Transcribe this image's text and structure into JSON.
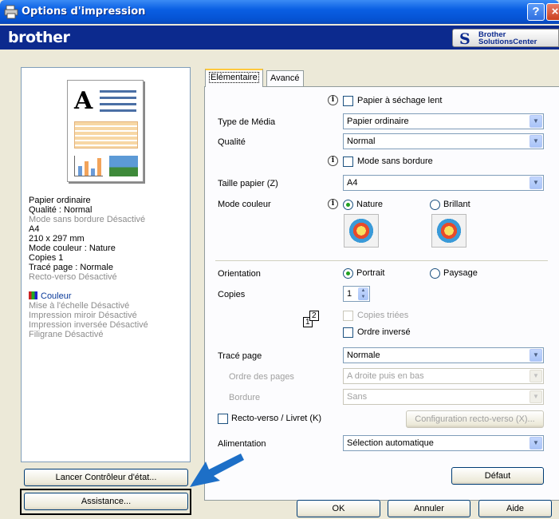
{
  "window": {
    "title": "Options d'impression",
    "help_glyph": "?",
    "close_glyph": "×"
  },
  "brand": {
    "logo": "brother",
    "solutions_line1": "Brother",
    "solutions_line2": "SolutionsCenter"
  },
  "summary": {
    "lines": [
      {
        "text": "Papier ordinaire",
        "grey": false
      },
      {
        "text": "Qualité : Normal",
        "grey": false
      },
      {
        "text": "Mode sans bordure Désactivé",
        "grey": true
      },
      {
        "text": "A4",
        "grey": false
      },
      {
        "text": "210 x 297 mm",
        "grey": false
      },
      {
        "text": "Mode couleur : Nature",
        "grey": false
      },
      {
        "text": "Copies 1",
        "grey": false
      },
      {
        "text": "Tracé page : Normale",
        "grey": false
      },
      {
        "text": "Recto-verso Désactivé",
        "grey": true
      }
    ],
    "color_label": "Couleur",
    "lines2": [
      "Mise à l'échelle Désactivé",
      "Impression miroir Désactivé",
      "Impression inversée Désactivé",
      "Filigrane Désactivé"
    ]
  },
  "left_buttons": {
    "status_monitor": "Lancer Contrôleur d'état...",
    "assistance": "Assistance..."
  },
  "tabs": [
    {
      "label": "Elémentaire",
      "active": true
    },
    {
      "label": "Avancé",
      "active": false
    }
  ],
  "form": {
    "slow_dry_label": "Papier à séchage lent",
    "media_type_label": "Type de Média",
    "media_type_value": "Papier ordinaire",
    "quality_label": "Qualité",
    "quality_value": "Normal",
    "borderless_label": "Mode sans bordure",
    "paper_size_label": "Taille papier (Z)",
    "paper_size_value": "A4",
    "color_mode_label": "Mode couleur",
    "color_mode_nature": "Nature",
    "color_mode_brillant": "Brillant",
    "orientation_label": "Orientation",
    "orientation_portrait": "Portrait",
    "orientation_paysage": "Paysage",
    "copies_label": "Copies",
    "copies_value": "1",
    "collate_label": "Copies triées",
    "reverse_order_label": "Ordre inversé",
    "page_layout_label": "Tracé page",
    "page_layout_value": "Normale",
    "page_order_label": "Ordre des pages",
    "page_order_value": "A droite puis en bas",
    "border_label": "Bordure",
    "border_value": "Sans",
    "duplex_label": "Recto-verso / Livret (K)",
    "duplex_config_label": "Configuration recto-verso (X)...",
    "paper_source_label": "Alimentation",
    "paper_source_value": "Sélection automatique",
    "default_button": "Défaut"
  },
  "dialog_buttons": {
    "ok": "OK",
    "cancel": "Annuler",
    "help": "Aide"
  },
  "colors": {
    "title_blue": "#0553d3",
    "brand_navy": "#0c2a8e",
    "arrow_blue": "#1d6fc7"
  }
}
